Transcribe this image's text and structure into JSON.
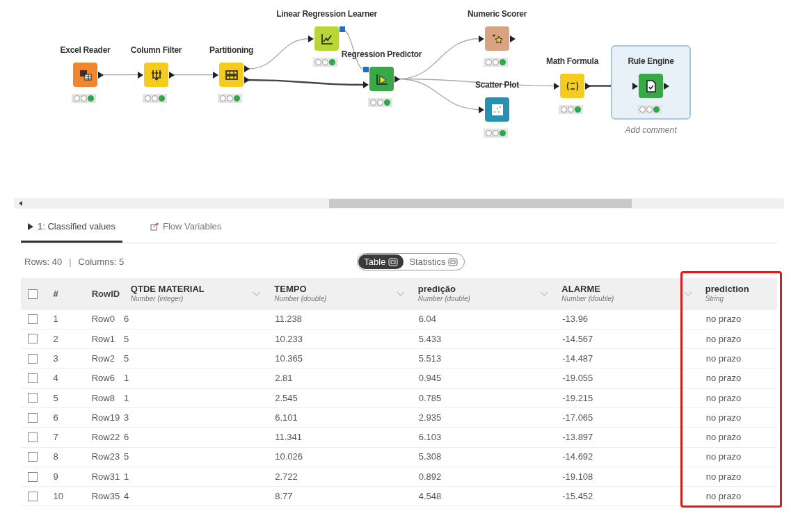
{
  "workflow": {
    "nodes": [
      {
        "label": "Excel Reader",
        "kind": "reader",
        "color": "#f0862d",
        "executed": true
      },
      {
        "label": "Column Filter",
        "kind": "filter",
        "color": "#f5cc1c",
        "executed": true
      },
      {
        "label": "Partitioning",
        "kind": "partition",
        "color": "#f5cc1c",
        "executed": true
      },
      {
        "label": "Linear Regression Learner",
        "kind": "learner",
        "color": "#b8d637",
        "executed": true
      },
      {
        "label": "Regression Predictor",
        "kind": "predictor",
        "color": "#3aa849",
        "executed": true
      },
      {
        "label": "Numeric Scorer",
        "kind": "scorer",
        "color": "#d9a383",
        "executed": true
      },
      {
        "label": "Scatter Plot",
        "kind": "plot",
        "color": "#2a90b2",
        "executed": true
      },
      {
        "label": "Math Formula",
        "kind": "formula",
        "color": "#f5cc1c",
        "executed": true
      },
      {
        "label": "Rule Engine",
        "kind": "rules",
        "color": "#3aa849",
        "executed": true,
        "selected": true,
        "annotation": "Add comment"
      }
    ]
  },
  "tabs": [
    {
      "label": "1: Classified values",
      "kind": "table",
      "selected": true
    },
    {
      "label": "Flow Variables",
      "kind": "variables",
      "selected": false
    }
  ],
  "summary": {
    "rows": "Rows: 40",
    "separator": "|",
    "columns": "Columns: 5"
  },
  "view_toggle": [
    {
      "label": "Table",
      "selected": true
    },
    {
      "label": "Statistics",
      "selected": false
    }
  ],
  "table": {
    "header_checked": false,
    "index_label": "#",
    "rowid_label": "RowID",
    "columns": [
      {
        "name": "QTDE MATERIAL",
        "type": "Number (integer)",
        "highlighted": false
      },
      {
        "name": "TEMPO",
        "type": "Number (double)",
        "highlighted": false
      },
      {
        "name": "predição",
        "type": "Number (double)",
        "highlighted": false
      },
      {
        "name": "ALARME",
        "type": "Number (double)",
        "highlighted": false
      },
      {
        "name": "prediction",
        "type": "String",
        "highlighted": true
      }
    ],
    "rows": [
      {
        "index": "1",
        "rowid": "Row0",
        "checked": false,
        "cells": [
          "6",
          "11.238",
          "6.04",
          "-13.96",
          "no prazo"
        ]
      },
      {
        "index": "2",
        "rowid": "Row1",
        "checked": false,
        "cells": [
          "5",
          "10.233",
          "5.433",
          "-14.567",
          "no prazo"
        ]
      },
      {
        "index": "3",
        "rowid": "Row2",
        "checked": false,
        "cells": [
          "5",
          "10.365",
          "5.513",
          "-14.487",
          "no prazo"
        ]
      },
      {
        "index": "4",
        "rowid": "Row6",
        "checked": false,
        "cells": [
          "1",
          "2.81",
          "0.945",
          "-19.055",
          "no prazo"
        ]
      },
      {
        "index": "5",
        "rowid": "Row8",
        "checked": false,
        "cells": [
          "1",
          "2.545",
          "0.785",
          "-19.215",
          "no prazo"
        ]
      },
      {
        "index": "6",
        "rowid": "Row19",
        "checked": false,
        "cells": [
          "3",
          "6.101",
          "2.935",
          "-17.065",
          "no prazo"
        ]
      },
      {
        "index": "7",
        "rowid": "Row22",
        "checked": false,
        "cells": [
          "6",
          "11.341",
          "6.103",
          "-13.897",
          "no prazo"
        ]
      },
      {
        "index": "8",
        "rowid": "Row23",
        "checked": false,
        "cells": [
          "5",
          "10.026",
          "5.308",
          "-14.692",
          "no prazo"
        ]
      },
      {
        "index": "9",
        "rowid": "Row31",
        "checked": false,
        "cells": [
          "1",
          "2.722",
          "0.892",
          "-19.108",
          "no prazo"
        ]
      },
      {
        "index": "10",
        "rowid": "Row35",
        "checked": false,
        "cells": [
          "4",
          "8.77",
          "4.548",
          "-15.452",
          "no prazo"
        ]
      }
    ]
  }
}
